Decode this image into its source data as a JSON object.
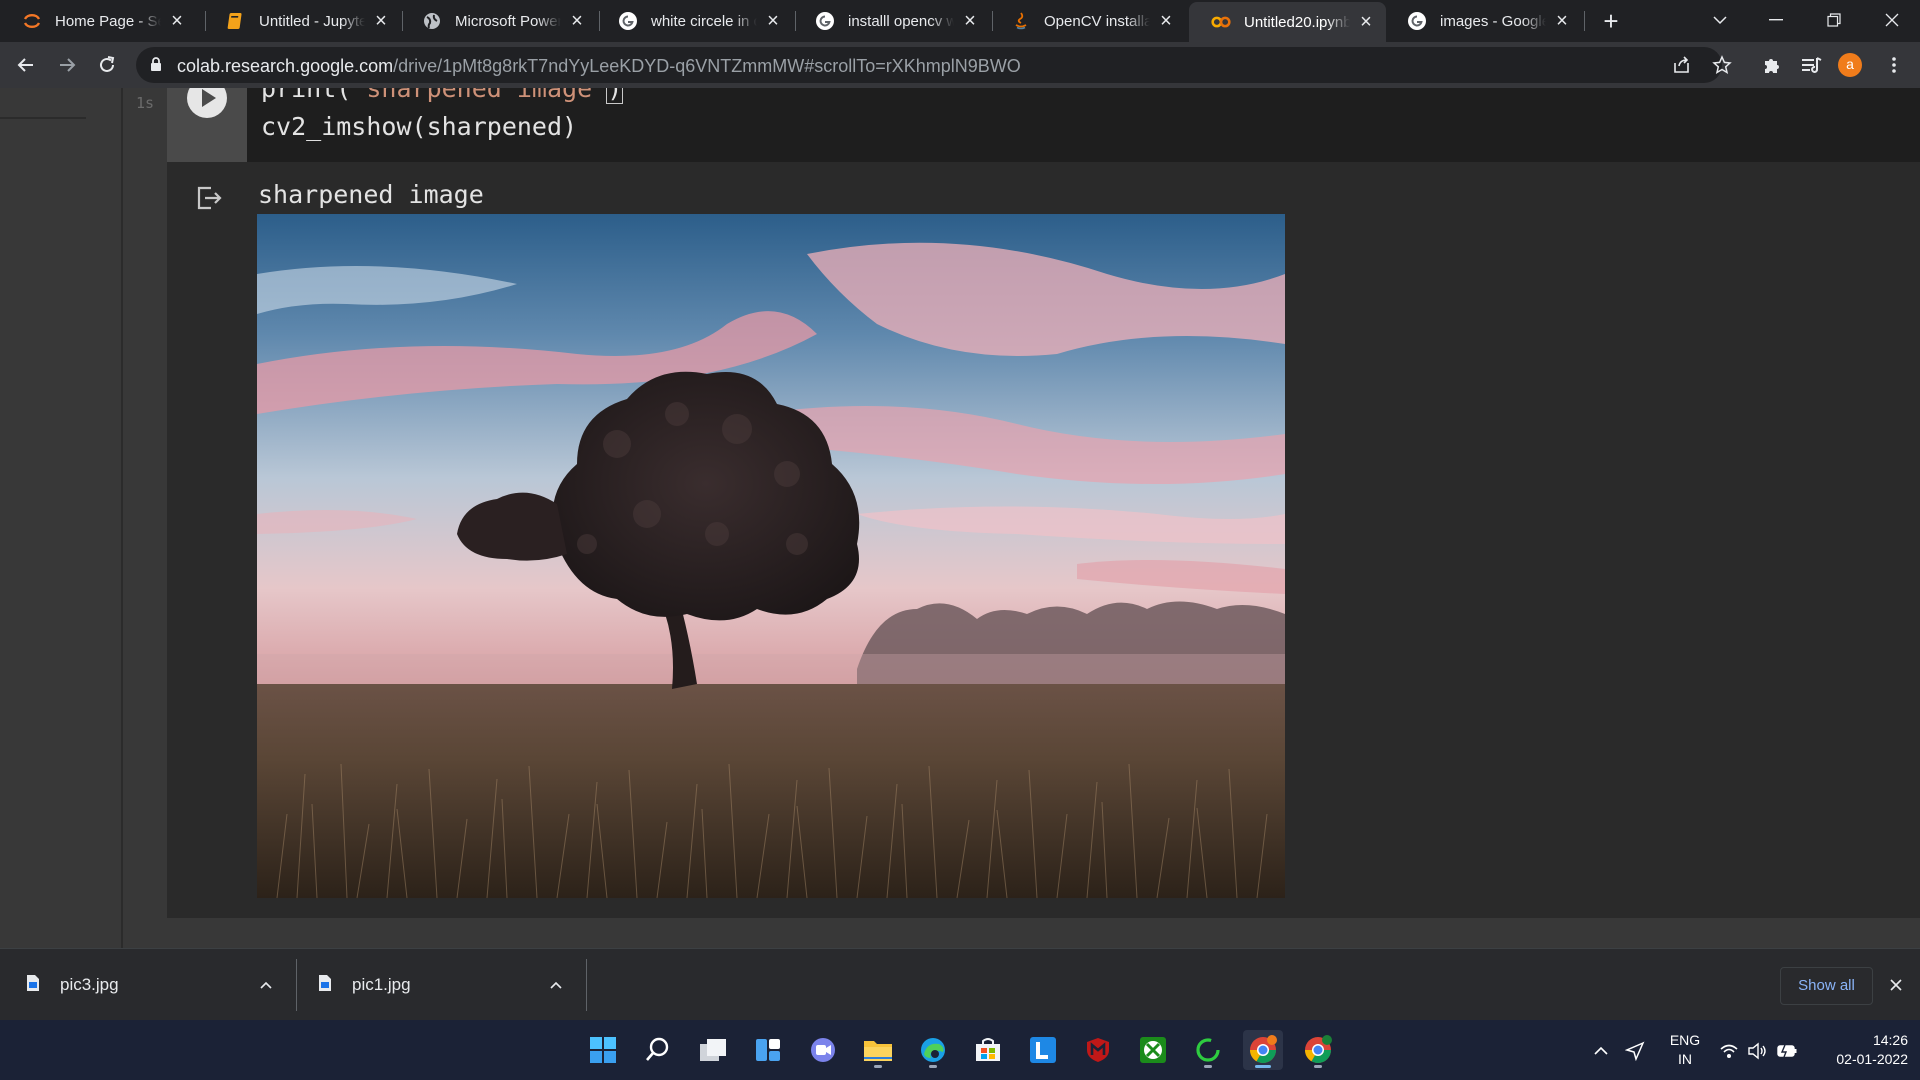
{
  "tabs": [
    {
      "title": "Home Page - Select or create a notebook",
      "icon": "jupyter-orange-ring-icon",
      "active": false
    },
    {
      "title": "Untitled - Jupyter Notebook",
      "icon": "jupyter-notebook-icon",
      "active": false
    },
    {
      "title": "Microsoft PowerPoint",
      "icon": "globe-icon",
      "active": false
    },
    {
      "title": "white circele in ce",
      "icon": "google-g-icon",
      "active": false
    },
    {
      "title": "installl opencv wi",
      "icon": "google-g-icon",
      "active": false
    },
    {
      "title": "OpenCV installati",
      "icon": "java-icon",
      "active": false
    },
    {
      "title": "Untitled20.ipynb",
      "icon": "colab-icon",
      "active": true
    },
    {
      "title": "images - Google",
      "icon": "google-g-icon",
      "active": false
    }
  ],
  "toolbar": {
    "url_host": "colab.research.google.com",
    "url_path": "/drive/1pMt8g8rkT7ndYyLeeKDYD-q6VNTZmmMW#scrollTo=rXKhmplN9BWO",
    "avatar_letter": "a"
  },
  "notebook": {
    "exec_count": "1s",
    "code_line_1_prefix": "print(",
    "code_line_1_string": "'sharpened image'",
    "code_line_1_suffix": ")",
    "code_line_2": "cv2_imshow(sharpened)",
    "output_text": "sharpened image",
    "output_image_icon": "landscape-tree-at-sunset"
  },
  "downloads": {
    "items": [
      {
        "name": "pic3.jpg",
        "icon": "file-icon"
      },
      {
        "name": "pic1.jpg",
        "icon": "file-icon"
      }
    ],
    "show_all_label": "Show all"
  },
  "taskbar": {
    "apps": [
      "windows-start-icon",
      "search-icon",
      "task-view-icon",
      "widgets-icon",
      "teams-chat-icon",
      "file-explorer-icon",
      "edge-icon",
      "store-icon",
      "l-app-icon",
      "mcafee-icon",
      "xbox-icon",
      "loading-ring-icon",
      "chrome-icon",
      "chrome-profile-icon"
    ],
    "language_line_1": "ENG",
    "language_line_2": "IN",
    "time": "14:26",
    "date": "02-01-2022"
  },
  "colors": {
    "chrome_dark": "#202124",
    "toolbar": "#35363a",
    "colab_bg": "#383838",
    "taskbar": "#1b2236",
    "link_blue": "#8ab4f8"
  }
}
